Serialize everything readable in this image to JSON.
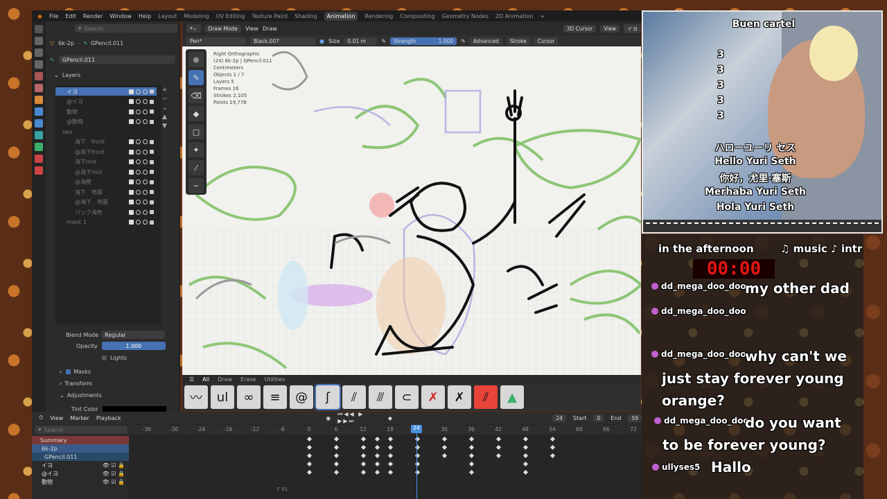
{
  "menubar": {
    "items": [
      "File",
      "Edit",
      "Render",
      "Window",
      "Help"
    ],
    "workspaces": [
      "Layout",
      "Modeling",
      "UV Editing",
      "Texture Paint",
      "Shading",
      "Animation",
      "Rendering",
      "Compositing",
      "Geometry Nodes",
      "2D Animation"
    ],
    "active_workspace": "Animation",
    "plus": "+"
  },
  "props": {
    "search_placeholder": "Search",
    "breadcrumb_obj": "6k-2p",
    "breadcrumb_data": "GPencil.011",
    "data_name": "GPencil.011",
    "layers_title": "Layers",
    "layers": [
      {
        "name": "イヨ",
        "selected": true
      },
      {
        "name": "@イヨ",
        "selected": false
      },
      {
        "name": "動物",
        "selected": false
      },
      {
        "name": "@動物",
        "selected": false
      },
      {
        "name": "sea",
        "selected": false
      },
      {
        "name": "海下　front",
        "selected": false
      },
      {
        "name": "@海下front",
        "selected": false
      },
      {
        "name": "海下mid",
        "selected": false
      },
      {
        "name": "@海下mid",
        "selected": false
      },
      {
        "name": "@海壁",
        "selected": false
      },
      {
        "name": "海下　地面",
        "selected": false
      },
      {
        "name": "@海下　地面",
        "selected": false
      },
      {
        "name": "バック海色",
        "selected": false
      },
      {
        "name": "mask 1",
        "selected": false
      }
    ],
    "blend_mode_label": "Blend Mode",
    "blend_mode": "Regular",
    "opacity_label": "Opacity",
    "opacity": "1.000",
    "lights_label": "Lights",
    "masks": "Masks",
    "transform": "Transform",
    "adjustments": "Adjustments",
    "tint_color": "Tint Color"
  },
  "viewport": {
    "mode": "Draw Mode",
    "view": "View",
    "draw": "Draw",
    "cursor": "3D Cursor",
    "view2": "View",
    "obj": "イヨ",
    "brush": "Pen*",
    "material": "Black.007",
    "size_label": "Size",
    "size": "0.01 m",
    "strength_label": "Strength",
    "strength": "1.000",
    "advanced": "Advanced",
    "stroke": "Stroke",
    "cursor2": "Cursor",
    "info": [
      "Right Orthographic",
      "(24) 6k-2p | GPencil.011",
      "Centimeters",
      "",
      "Objects   1 / 7",
      "Layers    5",
      "Frames    16",
      "Strokes   2,105",
      "Points    19,778"
    ]
  },
  "brush_tabs": [
    "All",
    "Draw",
    "Erase",
    "Utilities"
  ],
  "timeline": {
    "menus": [
      "View",
      "Marker",
      "Playback"
    ],
    "frame": "24",
    "start_label": "Start",
    "start": "0",
    "end_label": "End",
    "end": "59",
    "search_placeholder": "Search",
    "channels": [
      "Summary",
      "6k-2p",
      "GPencil.011",
      "イヨ",
      "@イヨ",
      "動物"
    ],
    "ticks": [
      "-36",
      "-30",
      "-24",
      "-18",
      "-12",
      "-6",
      "0",
      "6",
      "12",
      "18",
      "24",
      "30",
      "36",
      "42",
      "48",
      "54",
      "60",
      "66",
      "72"
    ],
    "current": "24",
    "frame_indicator": "F 01"
  },
  "stream": {
    "cam_lines": [
      "Buen cartel",
      "3",
      "3",
      "3",
      "3",
      "3",
      "ハローユーリ セス",
      "Hello Yuri Seth",
      "你好，尤里·塞斯",
      "Merhaba Yuri Seth",
      "Hola Yuri Seth"
    ],
    "ticker_left": "in the afternoon",
    "ticker_right": "♫ music ♪ intr",
    "timer": "00:00",
    "chat": [
      {
        "user": "dd_mega_doo_doo",
        "msg": "my other dad"
      },
      {
        "user": "dd_mega_doo_doo",
        "msg": ""
      },
      {
        "user": "dd_mega_doo_doo",
        "msg": "why can't we"
      },
      {
        "user": "",
        "msg": "just stay forever young"
      },
      {
        "user": "",
        "msg": "orange?"
      },
      {
        "user": "dd_mega_doo_doo",
        "msg": "do you want"
      },
      {
        "user": "",
        "msg": "to be forever young?"
      },
      {
        "user": "ullyses5",
        "msg": "Hallo"
      }
    ]
  }
}
